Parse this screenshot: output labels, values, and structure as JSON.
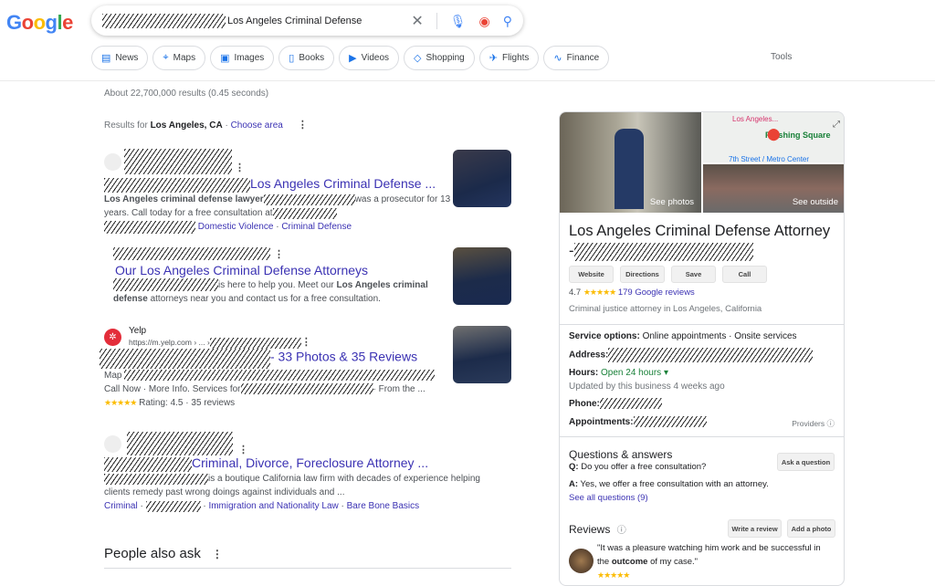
{
  "header": {
    "logo": "Google",
    "query": "Los Angeles Criminal Defense",
    "chips": [
      {
        "icon": "news-icon",
        "glyph": "▤",
        "label": "News"
      },
      {
        "icon": "maps-icon",
        "glyph": "⌖",
        "label": "Maps"
      },
      {
        "icon": "images-icon",
        "glyph": "▣",
        "label": "Images"
      },
      {
        "icon": "books-icon",
        "glyph": "▯",
        "label": "Books"
      },
      {
        "icon": "videos-icon",
        "glyph": "▶",
        "label": "Videos"
      },
      {
        "icon": "shopping-icon",
        "glyph": "◇",
        "label": "Shopping"
      },
      {
        "icon": "flights-icon",
        "glyph": "✈",
        "label": "Flights"
      },
      {
        "icon": "finance-icon",
        "glyph": "∿",
        "label": "Finance"
      }
    ],
    "tools": "Tools"
  },
  "stats": "About 22,700,000 results (0.45 seconds)",
  "results_for": {
    "prefix": "Results for ",
    "location": "Los Angeles, CA",
    "sep": " · ",
    "choose": "Choose area"
  },
  "results": [
    {
      "title": "Los Angeles Criminal Defense ...",
      "snip_bold": "Los Angeles criminal defense lawyer",
      "snip1": "was a prosecutor for 13",
      "snip2": "years. Call today for a free consultation at",
      "links": [
        "Domestic Violence",
        "Criminal Defense"
      ]
    },
    {
      "title": "Our Los Angeles Criminal Defense Attorneys",
      "snip1": "is here to help you. Meet our ",
      "snip_bold1": "Los Angeles criminal",
      "snip_bold2": "defense",
      "snip2": " attorneys near you and contact us for a free consultation."
    },
    {
      "site": "Yelp",
      "url": "https://m.yelp.com › ... ›",
      "title": "- 33 Photos & 35 Reviews",
      "map": "Map",
      "snip1": "Call Now · More Info. Services for",
      "snip2": "· From the ...",
      "stars": "★★★★★",
      "rating": "Rating: 4.5 · 35 reviews"
    },
    {
      "title": "Criminal, Divorce, Foreclosure Attorney ...",
      "snip1": "is a boutique California law firm with decades of experience helping",
      "snip2": "clients remedy past wrong doings against individuals and ...",
      "links": [
        "Criminal",
        "Immigration and Nationality Law",
        "Bare Bone Basics"
      ]
    }
  ],
  "people_also_ask": "People also ask",
  "panel": {
    "see_photos": "See photos",
    "see_outside": "See outside",
    "map_labels": [
      "Los Angeles...",
      "Pershing Square",
      "7th Street / Metro Center"
    ],
    "title": "Los Angeles Criminal Defense Attorney",
    "dash": "-",
    "buttons": [
      "Website",
      "Directions",
      "Save",
      "Call"
    ],
    "rating": "4.7",
    "stars": "★★★★★",
    "reviews_link": "179 Google reviews",
    "category": "Criminal justice attorney in Los Angeles, California",
    "service_label": "Service options:",
    "service_value": " Online appointments · Onsite services",
    "address_label": "Address:",
    "hours_label": "Hours:",
    "hours_value": " Open 24 hours ▾",
    "updated": "Updated by this business 4 weeks ago",
    "phone_label": "Phone:",
    "appt_label": "Appointments:",
    "providers": "Providers ⓘ",
    "qa_title": "Questions & answers",
    "ask": "Ask a question",
    "q_label": "Q:",
    "q": " Do you offer a free consultation?",
    "a_label": "A:",
    "a": " Yes, we offer a free consultation with an attorney.",
    "see_all": "See all questions (9)",
    "reviews_title": "Reviews",
    "info": "ⓘ",
    "write_review": "Write a review",
    "add_photo": "Add a photo",
    "review1": "\"It was a pleasure watching him work and be successful in",
    "review2a": "the ",
    "review2b": "outcome",
    "review2c": " of my case.\"",
    "review_stars": "★★★★★"
  }
}
